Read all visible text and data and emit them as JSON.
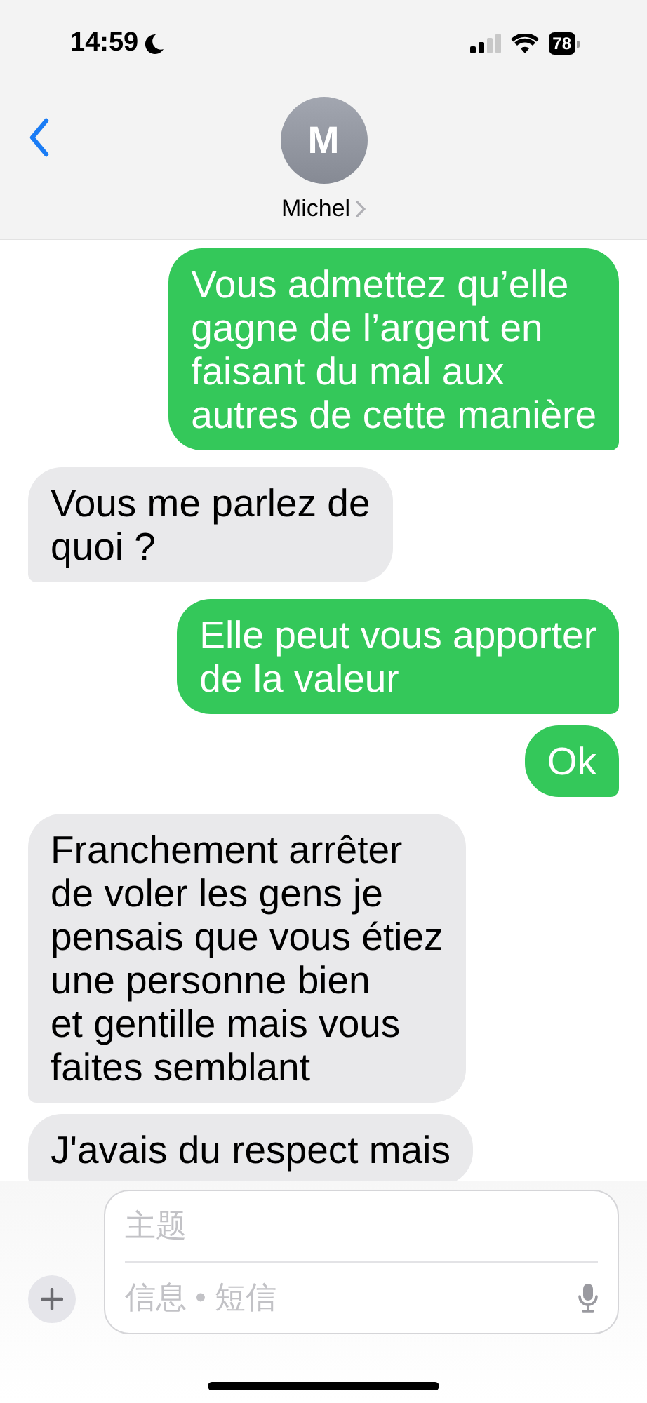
{
  "status_bar": {
    "time": "14:59",
    "focus_on": true,
    "battery": "78"
  },
  "header": {
    "avatar_initial": "M",
    "contact_name": "Michel"
  },
  "messages": [
    {
      "kind": "sent",
      "text": "Vous admettez qu’elle\ngagne de l’argent en\nfaisant du mal aux\nautres de cette manière"
    },
    {
      "kind": "received",
      "text": "Vous me parlez de\nquoi ?"
    },
    {
      "kind": "sent",
      "text": "Elle peut vous apporter\nde la valeur"
    },
    {
      "kind": "sent",
      "text": "Ok"
    },
    {
      "kind": "received",
      "text": "Franchement arrêter\nde voler les gens je\npensais que vous étiez\nune personne bien\net gentille mais vous\nfaites semblant"
    },
    {
      "kind": "received",
      "text": "J'avais du respect mais"
    }
  ],
  "compose": {
    "subject_placeholder": "主题",
    "message_placeholder": "信息 • 短信"
  }
}
